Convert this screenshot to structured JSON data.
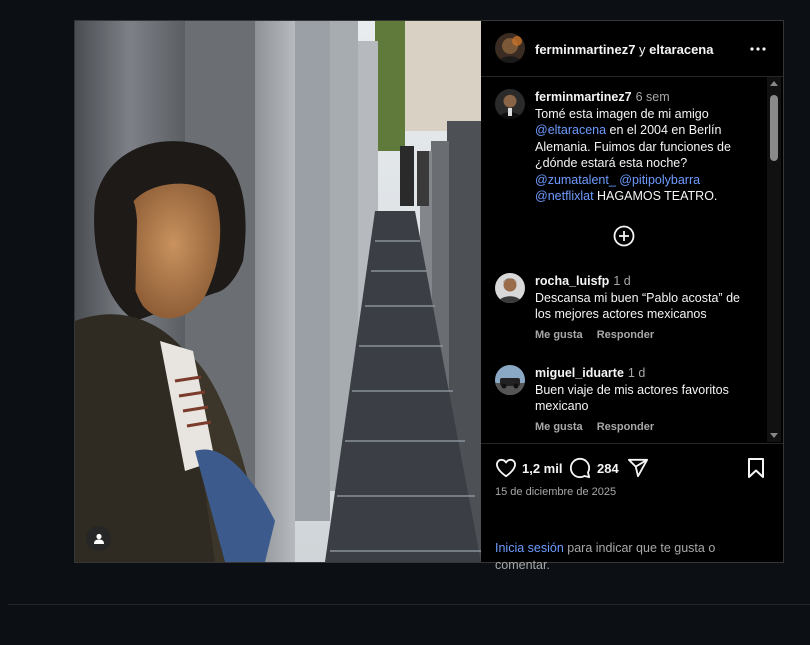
{
  "post": {
    "header": {
      "author": "ferminmartinez7",
      "connector": " y ",
      "collaborator": "eltaracena",
      "more_icon": "more-dots-icon"
    },
    "caption": {
      "username": "ferminmartinez7",
      "time": "6 sem",
      "text_1": "Tomé esta imagen de mi amigo ",
      "mention_1": "@eltaracena",
      "text_2": " en el 2004 en Berlín Alemania. Fuimos dar funciones de ¿dónde estará esta noche? ",
      "mention_2": "@zumatalent_",
      "text_3": " ",
      "mention_3": "@pitipolybarra",
      "text_4": " ",
      "mention_4": "@netflixlat",
      "text_5": " HAGAMOS TEATRO."
    },
    "comments": [
      {
        "username": "rocha_luisfp",
        "time": "1 d",
        "text": "Descansa mi buen “Pablo acosta” de los mejores actores mexicanos",
        "like_label": "Me gusta",
        "reply_label": "Responder"
      },
      {
        "username": "miguel_iduarte",
        "time": "1 d",
        "text": "Buen viaje de mis actores favoritos mexicano",
        "like_label": "Me gusta",
        "reply_label": "Responder"
      }
    ],
    "likes_count": "1,2 mil",
    "comments_count": "284",
    "date": "15 de diciembre de 2025",
    "login": {
      "link": "Inicia sesión",
      "rest": " para indicar que te gusta o comentar."
    }
  },
  "colors": {
    "background": "#0c1014",
    "link": "#6e9bff",
    "muted": "#a8a8a8"
  }
}
